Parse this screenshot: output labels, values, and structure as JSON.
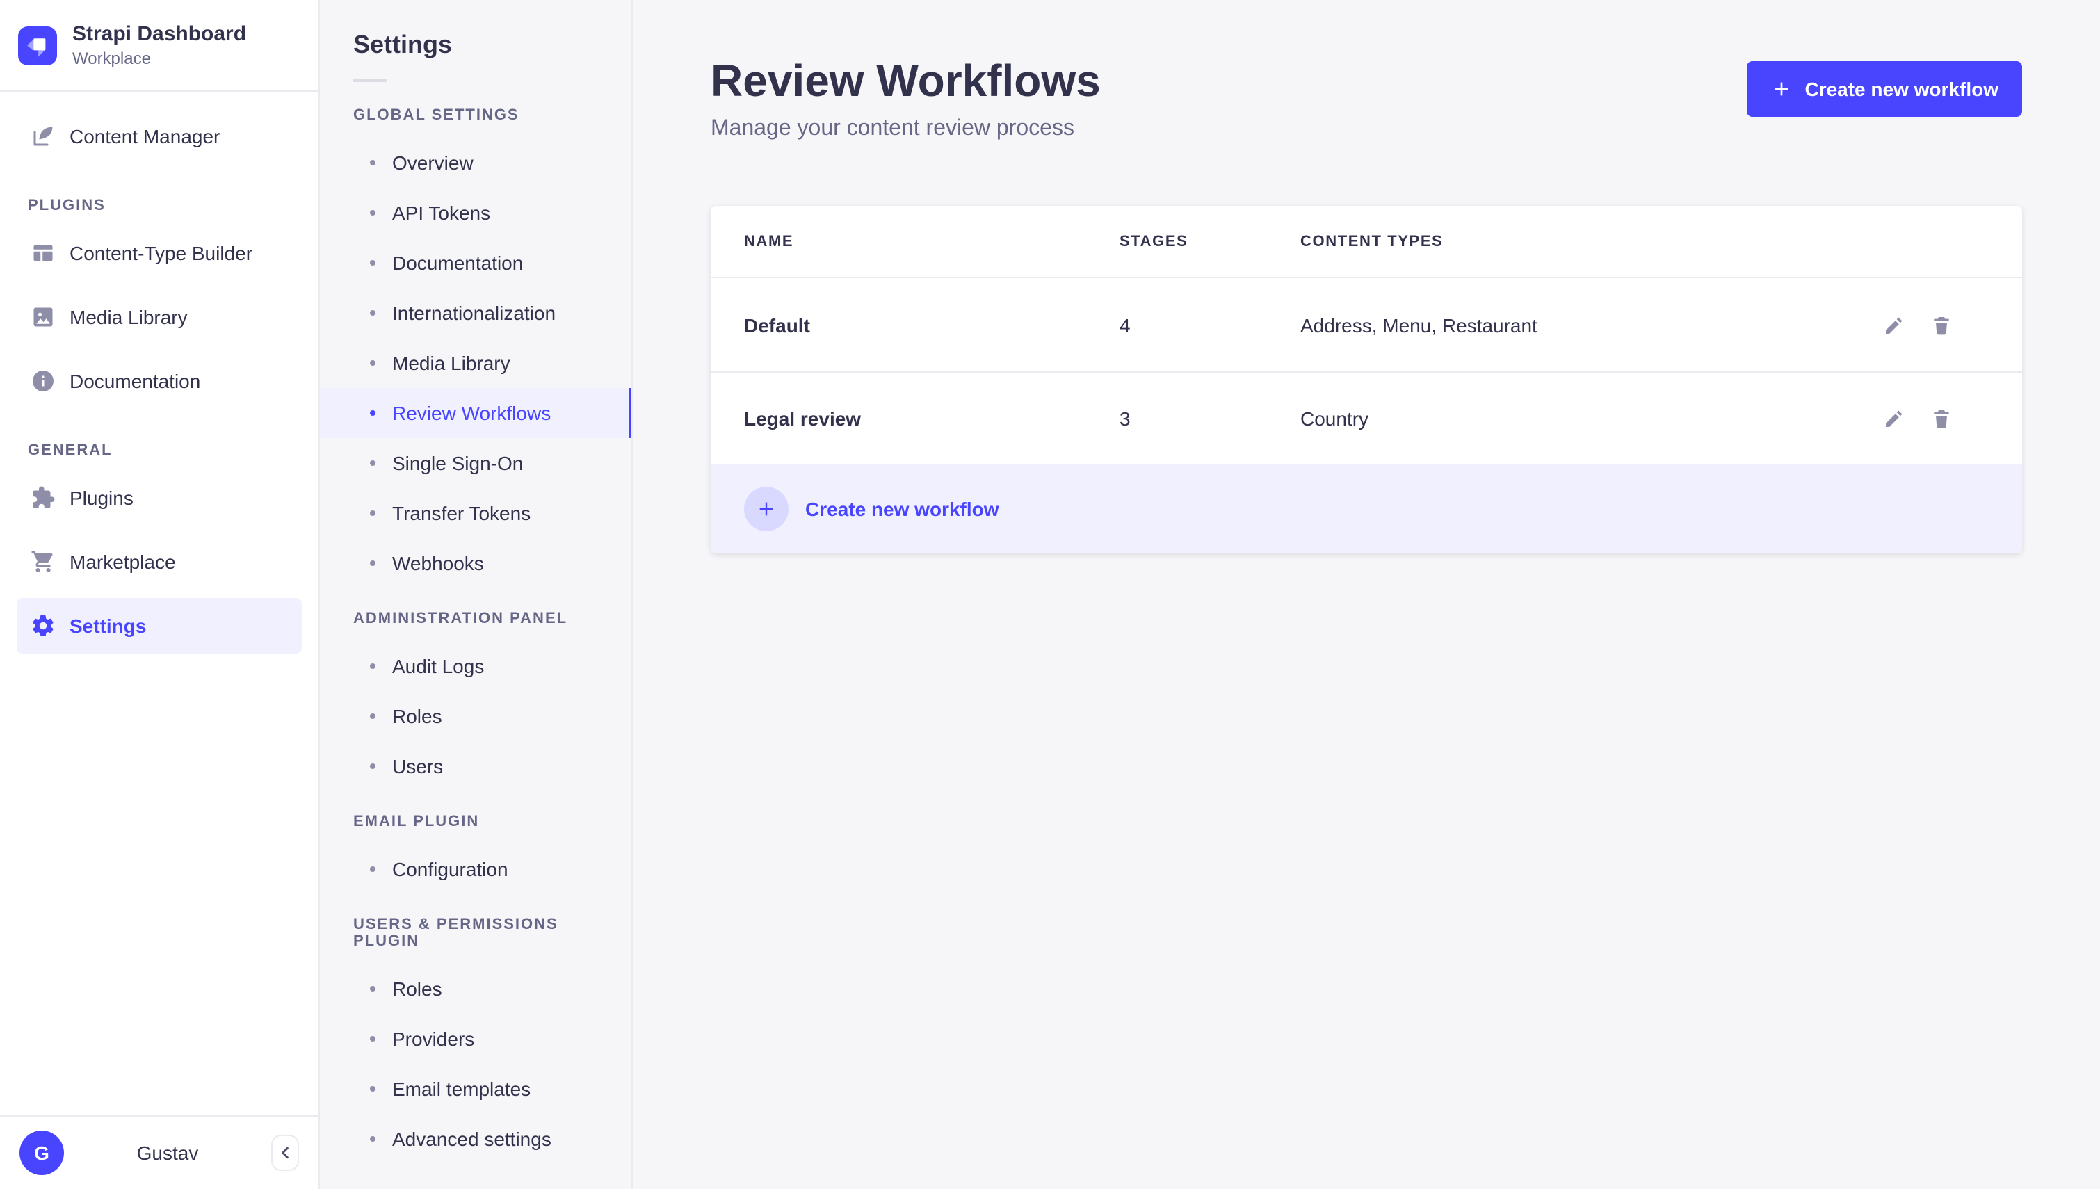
{
  "colors": {
    "primary": "#4945FF",
    "active_bg": "#F0F0FF",
    "text_dark": "#32324D",
    "text_muted": "#666687"
  },
  "brand": {
    "title": "Strapi Dashboard",
    "subtitle": "Workplace"
  },
  "sidebar": {
    "content_manager_label": "Content Manager",
    "sections": [
      {
        "label": "PLUGINS",
        "items": [
          {
            "label": "Content-Type Builder"
          },
          {
            "label": "Media Library"
          },
          {
            "label": "Documentation"
          }
        ]
      },
      {
        "label": "GENERAL",
        "items": [
          {
            "label": "Plugins"
          },
          {
            "label": "Marketplace"
          },
          {
            "label": "Settings"
          }
        ]
      }
    ],
    "user": {
      "name": "Gustav",
      "initial": "G"
    }
  },
  "subnav": {
    "title": "Settings",
    "active_item": "Review Workflows",
    "sections": [
      {
        "label": "GLOBAL SETTINGS",
        "items": [
          "Overview",
          "API Tokens",
          "Documentation",
          "Internationalization",
          "Media Library",
          "Review Workflows",
          "Single Sign-On",
          "Transfer Tokens",
          "Webhooks"
        ]
      },
      {
        "label": "ADMINISTRATION PANEL",
        "items": [
          "Audit Logs",
          "Roles",
          "Users"
        ]
      },
      {
        "label": "EMAIL PLUGIN",
        "items": [
          "Configuration"
        ]
      },
      {
        "label": "USERS & PERMISSIONS PLUGIN",
        "items": [
          "Roles",
          "Providers",
          "Email templates",
          "Advanced settings"
        ]
      }
    ]
  },
  "main": {
    "title": "Review Workflows",
    "subtitle": "Manage your content review process",
    "create_button_label": "Create new workflow",
    "table": {
      "headers": {
        "name": "NAME",
        "stages": "STAGES",
        "content_types": "CONTENT TYPES"
      },
      "rows": [
        {
          "name": "Default",
          "stages": "4",
          "content_types": "Address, Menu, Restaurant"
        },
        {
          "name": "Legal review",
          "stages": "3",
          "content_types": "Country"
        }
      ],
      "footer_action_label": "Create new workflow"
    }
  }
}
